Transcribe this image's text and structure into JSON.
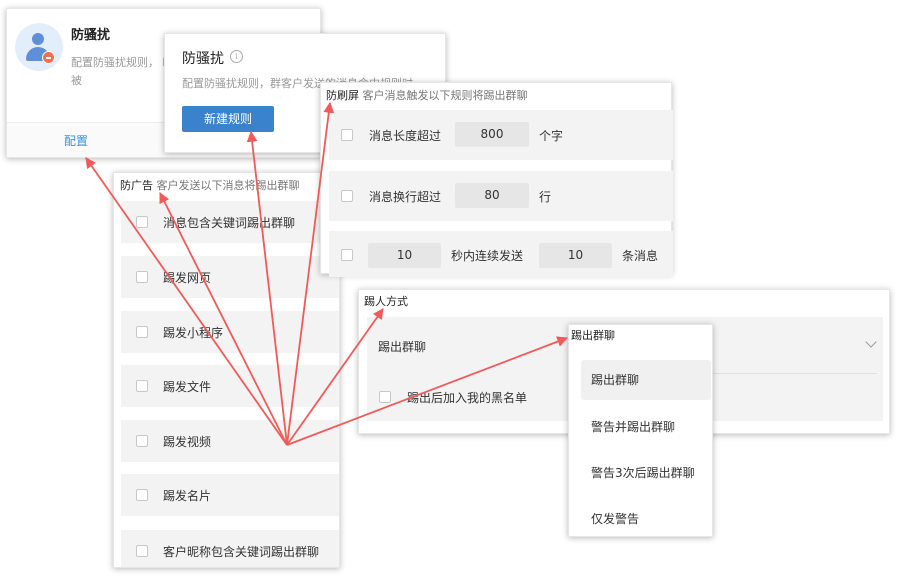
{
  "card_anti_harass": {
    "title": "防骚扰",
    "desc": "配置防骚扰规则， 时，该成员将会被",
    "config_link": "配置"
  },
  "card_rule": {
    "title": "防骚扰",
    "info_icon": "info-icon",
    "desc": "配置防骚扰规则，群客户发送的消息命中规则时",
    "new_rule_button": "新建规则"
  },
  "anti_flood": {
    "title": "防刷屏",
    "subtitle": "客户消息触发以下规则将踢出群聊",
    "row1": {
      "label": "消息长度超过",
      "value": "800",
      "unit": "个字"
    },
    "row2": {
      "label": "消息换行超过",
      "value": "80",
      "unit": "行"
    },
    "row3": {
      "value1": "10",
      "middle": "秒内连续发送",
      "value2": "10",
      "unit": "条消息"
    }
  },
  "anti_ads": {
    "title": "防广告",
    "subtitle": "客户发送以下消息将踢出群聊",
    "items": [
      "消息包含关键词踢出群聊",
      "踢发网页",
      "踢发小程序",
      "踢发文件",
      "踢发视频",
      "踢发名片",
      "客户昵称包含关键词踢出群聊"
    ]
  },
  "kick_method": {
    "title": "踢人方式",
    "label": "踢出群聊",
    "blacklist_label": "踢出后加入我的黑名单"
  },
  "dropdown": {
    "selected": "踢出群聊",
    "options": [
      "踢出群聊",
      "警告并踢出群聊",
      "警告3次后踢出群聊",
      "仅发警告"
    ]
  },
  "colors": {
    "arrow": "#f05a5a",
    "primary": "#3a82cc",
    "link": "#3a8ee6"
  }
}
